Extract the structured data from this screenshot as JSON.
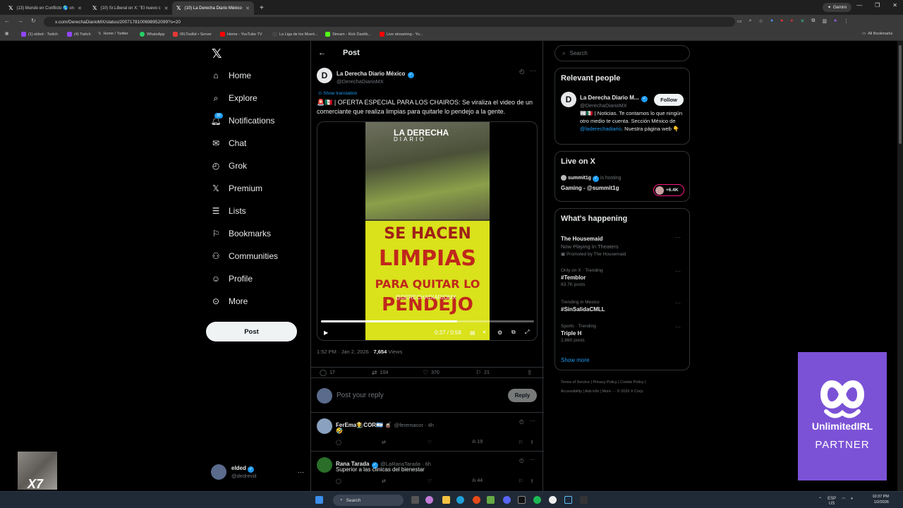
{
  "browser": {
    "tabs": [
      {
        "title": "(13) Mundo en Conflicto 🌎 on"
      },
      {
        "title": "(10) Sr.Liberal on X: \"El nuevo c"
      },
      {
        "title": "(10) La Derecha Diario México"
      }
    ],
    "new_tab": "+",
    "gemini": "Gemini",
    "url": "x.com/DerechaDiarioMX/status/2007178100698952099?s=20",
    "bookmarks": [
      "(1) elded - Twitch",
      "(4) Twitch",
      "Home / Twitter",
      "WhatsApp",
      "IRLToolkit • Server",
      "Home - YouTube TV",
      "La Liga de los Muert...",
      "Stream - Kick Dashb...",
      "Live streaming - Yo..."
    ],
    "all_bookmarks": "All Bookmarks"
  },
  "nav": {
    "items": [
      {
        "label": "Home",
        "icon": "home-icon"
      },
      {
        "label": "Explore",
        "icon": "search-icon"
      },
      {
        "label": "Notifications",
        "icon": "bell-icon"
      },
      {
        "label": "Chat",
        "icon": "mail-icon"
      },
      {
        "label": "Grok",
        "icon": "grok-icon"
      },
      {
        "label": "Premium",
        "icon": "x-icon"
      },
      {
        "label": "Lists",
        "icon": "list-icon"
      },
      {
        "label": "Bookmarks",
        "icon": "bookmark-icon"
      },
      {
        "label": "Communities",
        "icon": "people-icon"
      },
      {
        "label": "Profile",
        "icon": "person-icon"
      },
      {
        "label": "More",
        "icon": "more-icon"
      }
    ],
    "notif_count": "30",
    "post_label": "Post",
    "account": {
      "name": "elded",
      "handle": "@dedreviil"
    }
  },
  "post": {
    "header": "Post",
    "author_name": "La Derecha Diario México",
    "author_handle": "@DerechaDiarioMX",
    "show_translation": "Show translation",
    "text": "🚨🇲🇽 | OFERTA ESPECIAL PARA LOS CHAIROS: Se viraliza el video de un comerciante que realiza limpias para quitarle lo pendejo a la gente.",
    "video": {
      "logo_line1": "LA DERECHA",
      "logo_line2": "DIARIO",
      "sign_line1": "SE HACEN",
      "sign_line2": "LIMPIAS",
      "sign_line3": "PARA QUITAR LO",
      "sign_line4": "PENDEJO",
      "watermark": "@DERECHADIARIOMX",
      "time": "0:37 / 0:58",
      "progress": 0.64
    },
    "time": "1:52 PM · Jan 2, 2026 · ",
    "views_count": "7,654",
    "views_label": " Views",
    "replies": "17",
    "reposts": "104",
    "likes": "370",
    "bookmarks": "21",
    "reply_placeholder": "Post your reply",
    "reply_button": "Reply"
  },
  "replies": [
    {
      "name": "FerEma👨‍🌾COR🇦🇷 🧉",
      "handle": "@feremacor · 4h",
      "text": "🤣",
      "views": "19"
    },
    {
      "name": "Rana Tarada",
      "handle": "@LaRanaTarada · 6h",
      "text": "Superior a las clinicas del bienestar",
      "views": "44"
    }
  ],
  "right": {
    "search_placeholder": "Search",
    "relevant_title": "Relevant people",
    "person_name": "La Derecha Diario M...",
    "person_handle": "@DerechaDiarioMX",
    "follow": "Follow",
    "bio_pre": "📰🇲🇽 | Noticias. Te contamos lo que ningún otro medio te cuenta. Sección México de ",
    "bio_link": "@laderechadiario",
    "bio_post": ". Nuestra página web 👇",
    "live_title": "Live on X",
    "live_user": "summit1g",
    "live_hosting": "is hosting",
    "live_show": "Gaming - @summit1g",
    "live_count": "+6.4K",
    "happening_title": "What's happening",
    "trends": [
      {
        "meta": "",
        "name": "The Housemaid",
        "sub": "Now Playing In Theaters",
        "extra": "Promoted by The Housemaid"
      },
      {
        "meta": "Only on X · Trending",
        "name": "#Temblor",
        "sub": "83.7K posts",
        "extra": ""
      },
      {
        "meta": "Trending in Mexico",
        "name": "#SinSalidaCMLL",
        "sub": "",
        "extra": ""
      },
      {
        "meta": "Sports · Trending",
        "name": "Triple H",
        "sub": "2,860 posts",
        "extra": ""
      }
    ],
    "show_more": "Show more",
    "footer_line1": "Terms of Service  |  Privacy Policy  |  Cookie Policy  |",
    "footer_line2": "Accessibility  |  Ads info  |  More ···  © 2026 X Corp."
  },
  "overlay": {
    "partner_line1": "UnlimitedIRL",
    "partner_line2": "PARTNER"
  },
  "taskbar": {
    "search": "Search",
    "lang": "ESP",
    "lang2": "US",
    "time": "10:37 PM",
    "date": "1/2/2026"
  }
}
